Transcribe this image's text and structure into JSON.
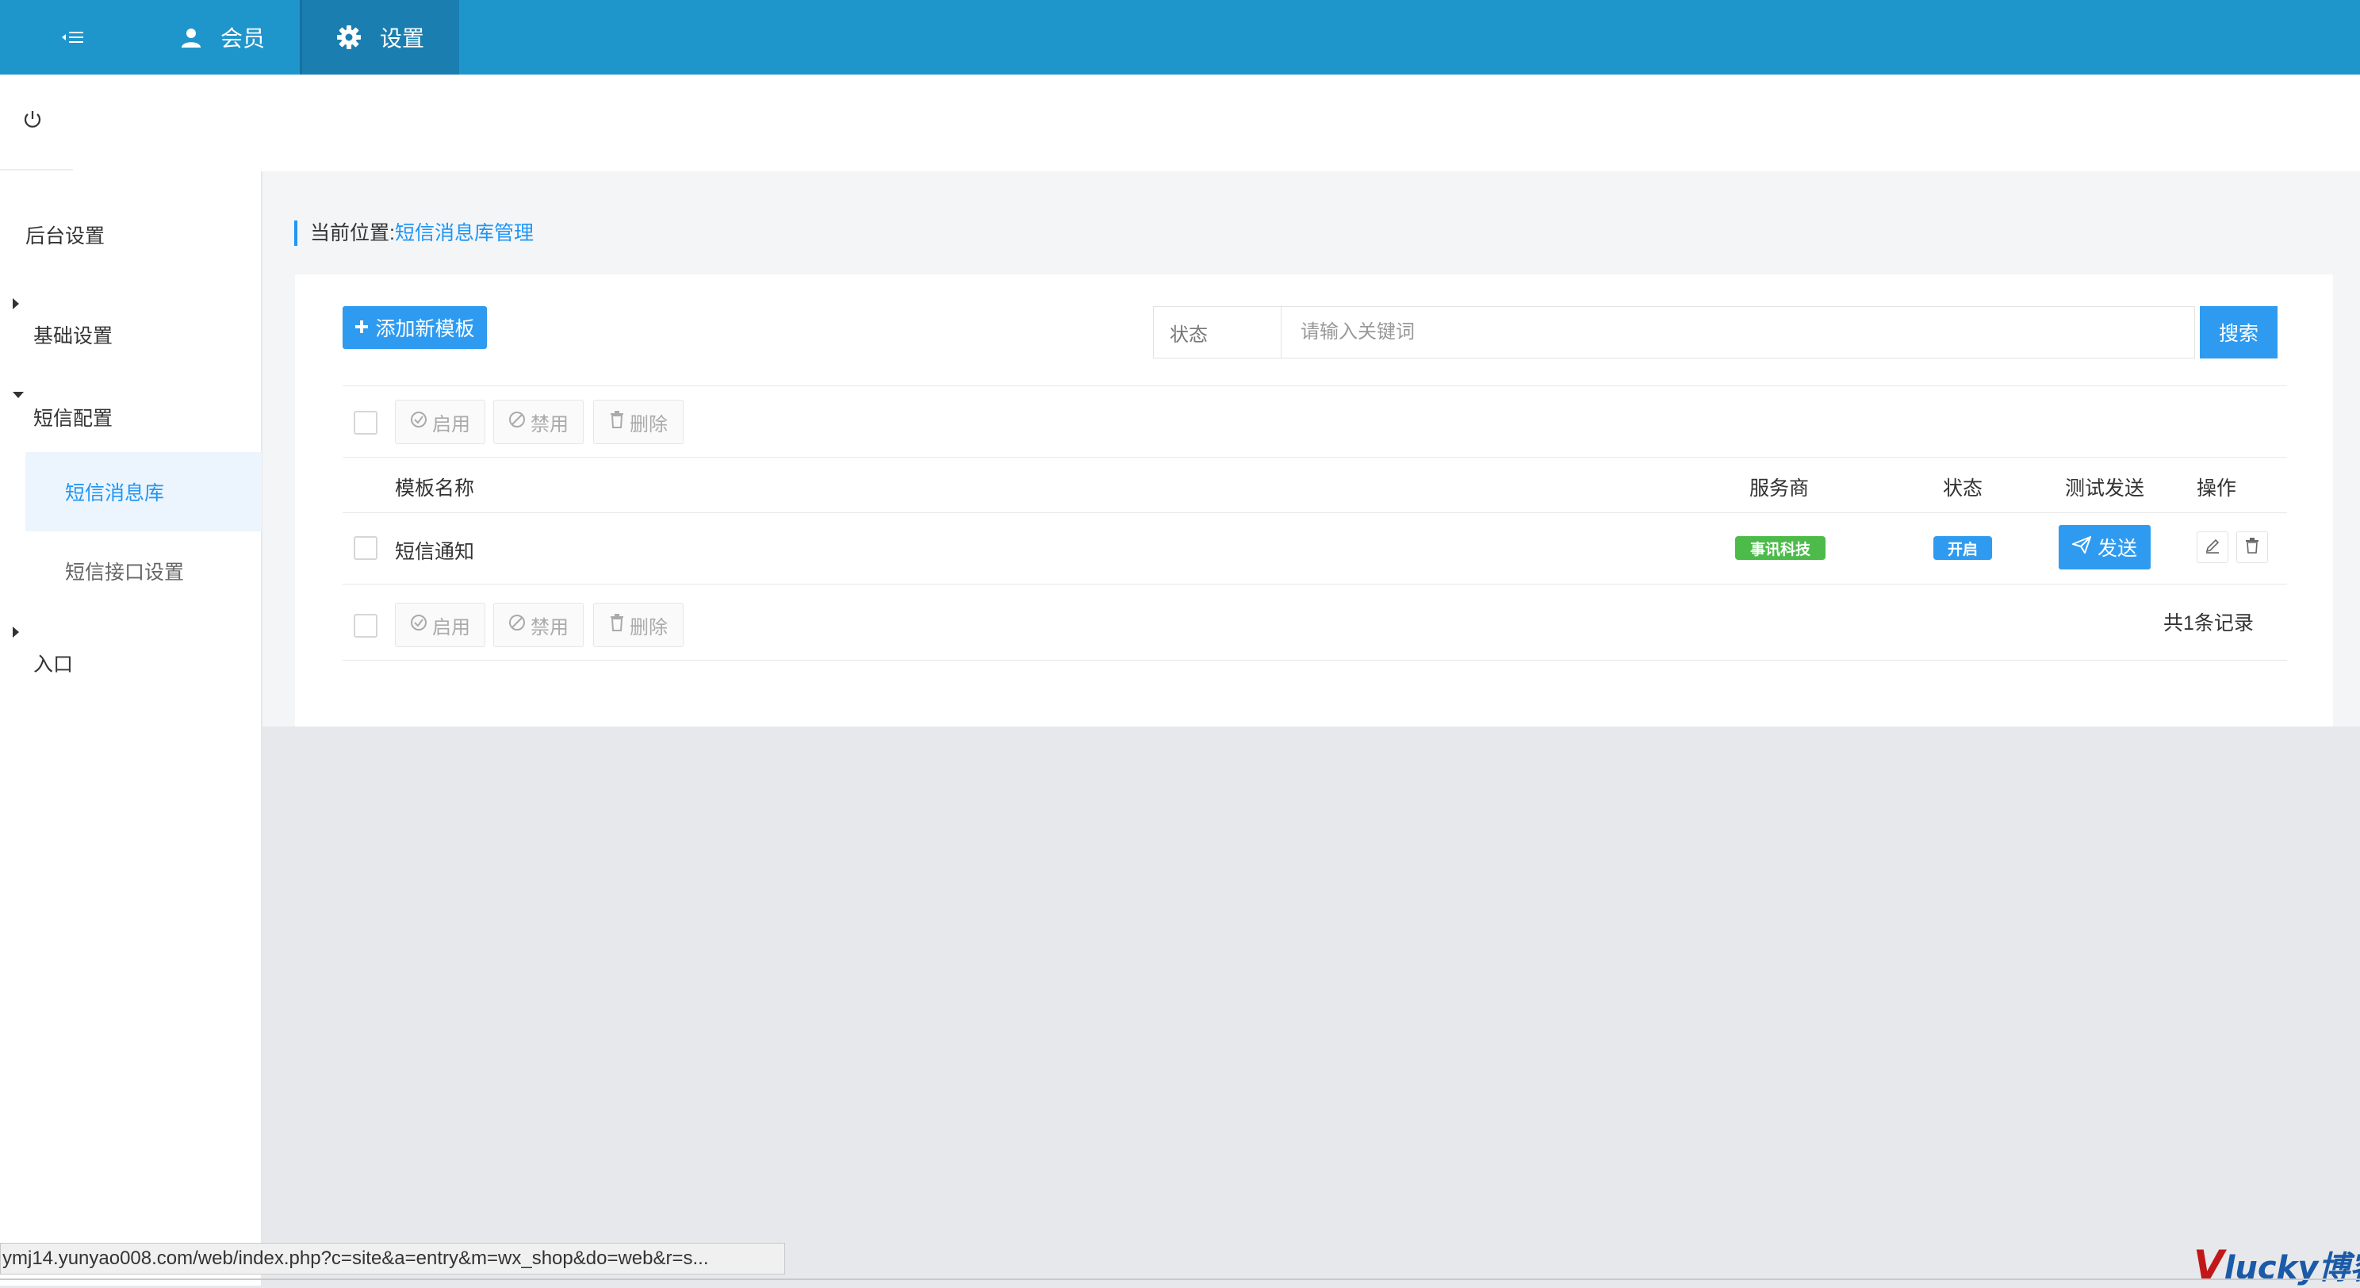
{
  "topnav": {
    "tabs": [
      {
        "label": "会员",
        "icon": "user-icon"
      },
      {
        "label": "设置",
        "icon": "gear-icon"
      }
    ]
  },
  "sidebar": {
    "title": "后台设置",
    "groups": [
      {
        "label": "基础设置",
        "expanded": false
      },
      {
        "label": "短信配置",
        "expanded": true,
        "items": [
          "短信消息库",
          "短信接口设置"
        ]
      },
      {
        "label": "入口",
        "expanded": false
      }
    ]
  },
  "breadcrumb": {
    "prefix": "当前位置:",
    "current": "短信消息库管理"
  },
  "toolbar": {
    "add_label": "添加新模板",
    "status_placeholder": "状态",
    "search_placeholder": "请输入关键词",
    "search_label": "搜索"
  },
  "bulk": {
    "enable": "启用",
    "disable": "禁用",
    "delete": "删除"
  },
  "table": {
    "columns": [
      "模板名称",
      "服务商",
      "状态",
      "测试发送",
      "操作"
    ],
    "rows": [
      {
        "name": "短信通知",
        "provider": "事讯科技",
        "status": "开启",
        "send": "发送"
      }
    ]
  },
  "total": "共1条记录",
  "statusbar": {
    "url": "ymj14.yunyao008.com/web/index.php?c=site&a=entry&m=wx_shop&do=web&r=s..."
  },
  "watermark": {
    "v": "V",
    "rest": "lucky博客"
  },
  "colors": {
    "primary": "#2e9bf0",
    "topbar": "#1e96cc",
    "provider_badge": "#4cbb4a",
    "status_badge": "#2e9bf0"
  }
}
